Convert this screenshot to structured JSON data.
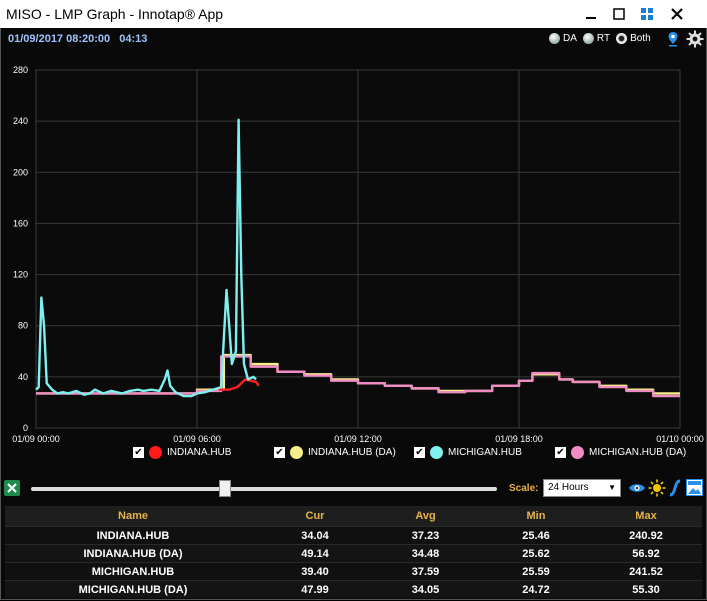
{
  "window": {
    "title": "MISO - LMP Graph - Innotap® App"
  },
  "info": {
    "datetime": "01/09/2017 08:20:00",
    "countdown": "04:13"
  },
  "modes": [
    {
      "label": "DA",
      "selected": false
    },
    {
      "label": "RT",
      "selected": false
    },
    {
      "label": "Both",
      "selected": true
    }
  ],
  "chart_data": {
    "type": "line",
    "ylim": [
      0,
      280
    ],
    "yticks": [
      0,
      40,
      80,
      120,
      160,
      200,
      240,
      280
    ],
    "xlim_hours": [
      0,
      24
    ],
    "xticks": [
      {
        "h": 0,
        "label": "01/09 00:00"
      },
      {
        "h": 6,
        "label": "01/09 06:00"
      },
      {
        "h": 12,
        "label": "01/09 12:00"
      },
      {
        "h": 18,
        "label": "01/09 18:00"
      },
      {
        "h": 24,
        "label": "01/10 00:00"
      }
    ],
    "grid": true,
    "series": [
      {
        "name": "INDIANA.HUB (DA)",
        "color": "#f5f08a",
        "step": true,
        "points": [
          [
            0,
            27
          ],
          [
            6,
            30
          ],
          [
            7,
            57
          ],
          [
            8,
            50
          ],
          [
            9,
            44
          ],
          [
            10,
            42
          ],
          [
            11,
            38
          ],
          [
            12,
            35
          ],
          [
            13,
            33
          ],
          [
            14,
            31
          ],
          [
            15,
            29
          ],
          [
            16,
            29
          ],
          [
            17,
            33
          ],
          [
            18,
            37
          ],
          [
            18.5,
            42
          ],
          [
            19.5,
            38
          ],
          [
            20,
            36
          ],
          [
            21,
            33
          ],
          [
            22,
            30
          ],
          [
            23,
            27
          ],
          [
            24,
            27
          ]
        ]
      },
      {
        "name": "MICHIGAN.HUB (DA)",
        "color": "#f08cc4",
        "step": true,
        "points": [
          [
            0,
            27
          ],
          [
            6,
            29
          ],
          [
            6.9,
            56
          ],
          [
            8,
            48
          ],
          [
            9,
            44
          ],
          [
            10,
            41
          ],
          [
            11,
            37
          ],
          [
            12,
            35
          ],
          [
            13,
            33
          ],
          [
            14,
            31
          ],
          [
            15,
            28
          ],
          [
            16,
            29
          ],
          [
            17,
            33
          ],
          [
            18,
            37
          ],
          [
            18.5,
            43
          ],
          [
            19.5,
            38
          ],
          [
            20,
            36
          ],
          [
            21,
            32
          ],
          [
            22,
            29
          ],
          [
            23,
            25
          ],
          [
            24,
            25
          ]
        ]
      },
      {
        "name": "INDIANA.HUB",
        "color": "#ff2020",
        "step": false,
        "points": [
          [
            6.8,
            30
          ],
          [
            7.2,
            30
          ],
          [
            7.5,
            32
          ],
          [
            7.8,
            38
          ],
          [
            8.0,
            37
          ],
          [
            8.2,
            36
          ],
          [
            8.3,
            33
          ]
        ]
      },
      {
        "name": "MICHIGAN.HUB",
        "color": "#7ff0f0",
        "step": false,
        "points": [
          [
            0,
            30
          ],
          [
            0.1,
            32
          ],
          [
            0.2,
            102
          ],
          [
            0.3,
            80
          ],
          [
            0.4,
            35
          ],
          [
            0.6,
            30
          ],
          [
            0.8,
            27
          ],
          [
            1.0,
            28
          ],
          [
            1.2,
            27
          ],
          [
            1.5,
            29
          ],
          [
            1.8,
            26
          ],
          [
            2.0,
            27
          ],
          [
            2.2,
            30
          ],
          [
            2.5,
            27
          ],
          [
            2.8,
            29
          ],
          [
            3.0,
            28
          ],
          [
            3.2,
            27
          ],
          [
            3.5,
            29
          ],
          [
            3.8,
            30
          ],
          [
            4.0,
            29
          ],
          [
            4.3,
            30
          ],
          [
            4.6,
            29
          ],
          [
            4.8,
            38
          ],
          [
            4.9,
            45
          ],
          [
            5.0,
            33
          ],
          [
            5.2,
            28
          ],
          [
            5.5,
            25
          ],
          [
            5.8,
            25
          ],
          [
            6.0,
            27
          ],
          [
            6.3,
            28
          ],
          [
            6.6,
            30
          ],
          [
            6.9,
            32
          ],
          [
            7.1,
            108
          ],
          [
            7.2,
            80
          ],
          [
            7.3,
            50
          ],
          [
            7.45,
            60
          ],
          [
            7.55,
            241
          ],
          [
            7.65,
            120
          ],
          [
            7.75,
            50
          ],
          [
            7.9,
            38
          ],
          [
            8.1,
            40
          ],
          [
            8.2,
            38
          ]
        ]
      }
    ]
  },
  "legend": [
    {
      "name": "INDIANA.HUB",
      "color": "#ff1a1a"
    },
    {
      "name": "INDIANA.HUB (DA)",
      "color": "#f5f08a"
    },
    {
      "name": "MICHIGAN.HUB",
      "color": "#7ff0f0"
    },
    {
      "name": "MICHIGAN.HUB (DA)",
      "color": "#f08cc4"
    }
  ],
  "toolbar": {
    "scale_label": "Scale:",
    "scale_value": "24 Hours",
    "slider_fraction": 0.4
  },
  "table": {
    "headers": {
      "name": "Name",
      "cur": "Cur",
      "avg": "Avg",
      "min": "Min",
      "max": "Max"
    },
    "rows": [
      {
        "name": "INDIANA.HUB",
        "cur": "34.04",
        "avg": "37.23",
        "min": "25.46",
        "max": "240.92"
      },
      {
        "name": "INDIANA.HUB (DA)",
        "cur": "49.14",
        "avg": "34.48",
        "min": "25.62",
        "max": "56.92"
      },
      {
        "name": "MICHIGAN.HUB",
        "cur": "39.40",
        "avg": "37.59",
        "min": "25.59",
        "max": "241.52"
      },
      {
        "name": "MICHIGAN.HUB (DA)",
        "cur": "47.99",
        "avg": "34.05",
        "min": "24.72",
        "max": "55.30"
      }
    ]
  }
}
